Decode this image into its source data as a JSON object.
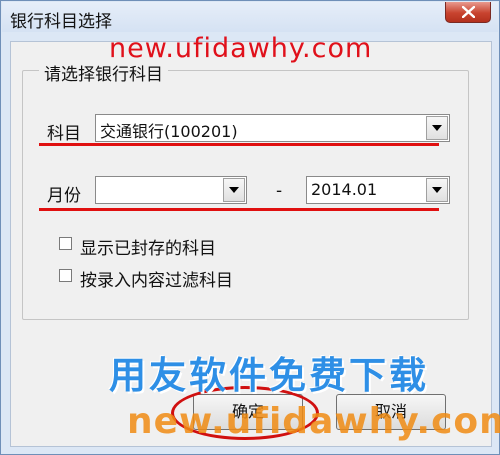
{
  "window": {
    "title": "银行科目选择"
  },
  "watermarks": {
    "top_url": "new.ufidawhy.com",
    "blue_text": "用友软件免费下载",
    "bottom_url": "new.ufidawhy.com"
  },
  "group": {
    "legend": "请选择银行科目"
  },
  "subject": {
    "label": "科目",
    "value": "交通银行(100201)"
  },
  "month": {
    "label": "月份",
    "from_value": "",
    "separator": "-",
    "to_value": "2014.01"
  },
  "options": [
    {
      "label": "显示已封存的科目",
      "checked": false
    },
    {
      "label": "按录入内容过滤科目",
      "checked": false
    }
  ],
  "buttons": {
    "ok_label": "确定",
    "cancel_label": "取消"
  },
  "colors": {
    "highlight_red": "#e01010",
    "watermark_blue": "#2e8fe6",
    "watermark_orange": "#f08c14"
  }
}
